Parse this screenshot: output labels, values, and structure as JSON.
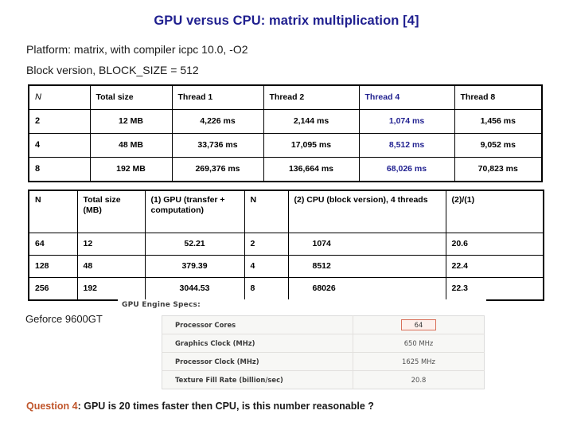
{
  "slide": {
    "title": "GPU versus CPU: matrix multiplication [4]",
    "title_color": "#1f1f8f",
    "intro_line_1": "Platform: matrix, with compiler icpc 10.0, -O2",
    "intro_line_2": "Block version, BLOCK_SIZE = 512"
  },
  "table_threads": {
    "highlight_color": "#1f1f8f",
    "highlight_column_index": 4,
    "headers": [
      "N",
      "Total size",
      "Thread 1",
      "Thread 2",
      "Thread 4",
      "Thread 8"
    ],
    "rows": [
      [
        "2",
        "12 MB",
        "4,226 ms",
        "2,144  ms",
        "1,074 ms",
        "1,456 ms"
      ],
      [
        "4",
        "48 MB",
        "33,736 ms",
        "17,095 ms",
        "8,512 ms",
        "9,052 ms"
      ],
      [
        "8",
        "192 MB",
        "269,376  ms",
        "136,664 ms",
        "68,026 ms",
        "70,823 ms"
      ]
    ]
  },
  "table_gpucpu": {
    "headers": [
      "N",
      "Total size (MB)",
      "(1) GPU (transfer + computation)",
      "N",
      "(2) CPU (block version), 4 threads",
      "(2)/(1)"
    ],
    "rows": [
      [
        "64",
        "12",
        "52.21",
        "2",
        "1074",
        "20.6"
      ],
      [
        "128",
        "48",
        "379.39",
        "4",
        "8512",
        "22.4"
      ],
      [
        "256",
        "192",
        "3044.53",
        "8",
        "68026",
        "22.3"
      ]
    ]
  },
  "gpu_card": {
    "caption": "Geforce 9600GT",
    "specs_heading": "GPU Engine Specs:",
    "highlight_color": "#d9705a",
    "specs": [
      {
        "name": "Processor Cores",
        "value": "64",
        "highlighted": true
      },
      {
        "name": "Graphics Clock (MHz)",
        "value": "650 MHz",
        "highlighted": false
      },
      {
        "name": "Processor Clock (MHz)",
        "value": "1625 MHz",
        "highlighted": false
      },
      {
        "name": "Texture Fill Rate (billion/sec)",
        "value": "20.8",
        "highlighted": false
      }
    ]
  },
  "footer": {
    "question_prefix": "Question 4",
    "question_prefix_color": "#c0562c",
    "question_body": ": GPU is 20 times faster then CPU, is this number reasonable ?"
  }
}
